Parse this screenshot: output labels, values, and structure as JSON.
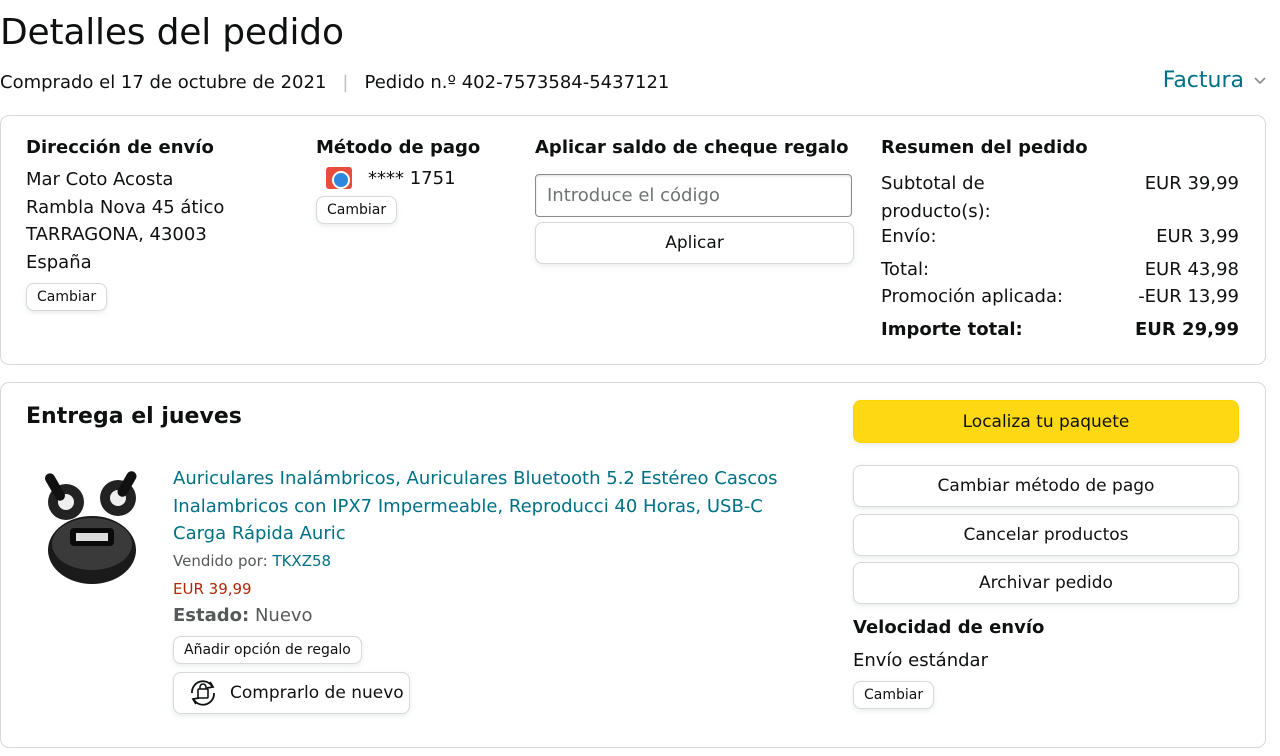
{
  "header": {
    "title": "Detalles del pedido",
    "purchased": "Comprado el 17 de octubre de 2021",
    "separator": "|",
    "order_number": "Pedido n.º 402-7573584-5437121",
    "invoice_label": "Factura",
    "invoice_icon": "chevron-down-icon"
  },
  "shipping": {
    "title": "Dirección de envío",
    "lines": [
      "Mar Coto Acosta",
      "Rambla Nova 45 ático",
      "TARRAGONA, 43003",
      "España"
    ],
    "change_label": "Cambiar"
  },
  "payment": {
    "title": "Método de pago",
    "card_icon": "credit-card-icon",
    "card_number": "**** 1751",
    "change_label": "Cambiar"
  },
  "gift_card": {
    "title": "Aplicar saldo de cheque regalo",
    "placeholder": "Introduce el código",
    "apply_label": "Aplicar"
  },
  "summary": {
    "title": "Resumen del pedido",
    "subtotal_label_1": "Subtotal de",
    "subtotal_label_2": "producto(s):",
    "subtotal_value": "EUR 39,99",
    "shipping_label": "Envío:",
    "shipping_value": "EUR 3,99",
    "total_label": "Total:",
    "total_value": "EUR 43,98",
    "promo_label": "Promoción aplicada:",
    "promo_value": "-EUR 13,99",
    "grand_label": "Importe total:",
    "grand_value": "EUR 29,99"
  },
  "delivery": {
    "title": "Entrega el jueves",
    "product": {
      "title": "Auriculares Inalámbricos, Auriculares Bluetooth 5.2 Estéreo Cascos Inalambricos con IPX7 Impermeable, Reproducci 40 Horas, USB-C Carga Rápida Auric",
      "sold_by_label": "Vendido por:",
      "seller": "TKXZ58",
      "price": "EUR 39,99",
      "condition_label": "Estado:",
      "condition_value": "Nuevo",
      "gift_option_label": "Añadir opción de regalo",
      "buy_again_label": "Comprarlo de nuevo",
      "buy_again_icon": "buy-again-icon"
    }
  },
  "actions": {
    "track": "Localiza tu paquete",
    "change_payment": "Cambiar método de pago",
    "cancel": "Cancelar productos",
    "archive": "Archivar pedido",
    "speed_title": "Velocidad de envío",
    "speed_value": "Envío estándar",
    "speed_change": "Cambiar"
  },
  "colors": {
    "link": "#007185",
    "price": "#b12704",
    "track_button": "#ffd814",
    "border": "#d5d9d9"
  }
}
